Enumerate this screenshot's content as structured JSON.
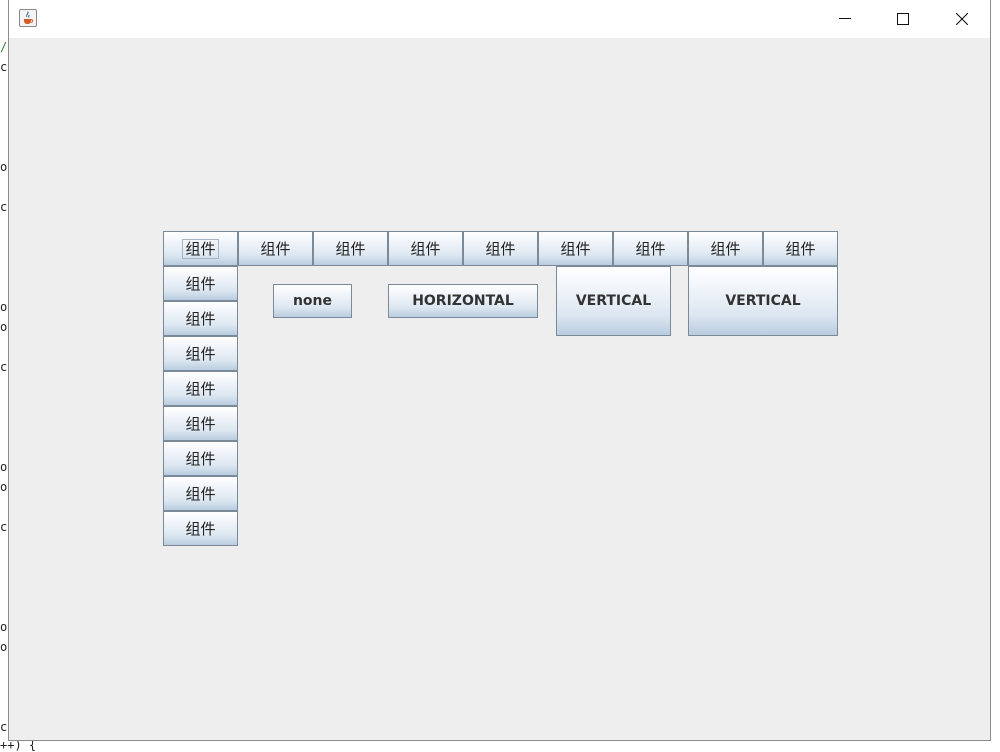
{
  "window": {
    "icon": "java-cup-icon",
    "controls": [
      "minimize-icon",
      "maximize-icon",
      "close-icon"
    ]
  },
  "background_editor": {
    "fragments": [
      "/",
      "cs",
      "or",
      "cs",
      "or",
      "or",
      "cs",
      "or",
      "or",
      "cs",
      "or",
      "or",
      "ct",
      "++) {"
    ]
  },
  "buttons": {
    "component_label": "组件",
    "row_count": 9,
    "column_count": 8,
    "fill_none": "none",
    "fill_horizontal": "HORIZONTAL",
    "fill_vertical": "VERTICAL",
    "fill_vertical_2": "VERTICAL"
  }
}
